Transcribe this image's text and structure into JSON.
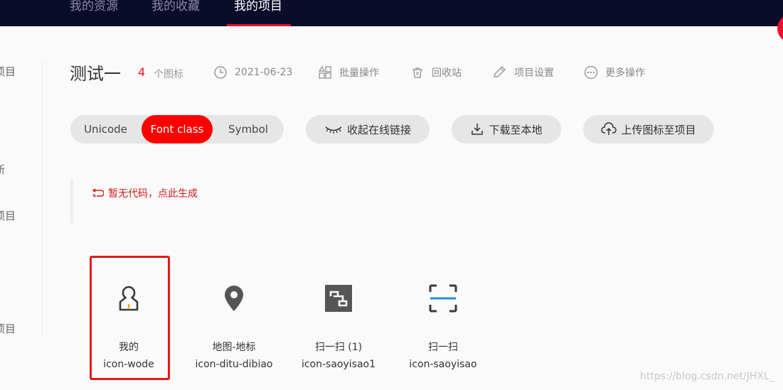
{
  "topnav": {
    "items": [
      {
        "label": "我的资源"
      },
      {
        "label": "我的收藏"
      },
      {
        "label": "我的项目",
        "active": true
      }
    ]
  },
  "sidebar": {
    "fragments": [
      "项目",
      "新",
      "项目",
      "项目"
    ]
  },
  "project": {
    "title": "测试一",
    "icon_count": "4",
    "icon_count_label": "个图标",
    "date": "2021-06-23",
    "batch_label": "批量操作",
    "recycle_label": "回收站",
    "settings_label": "项目设置",
    "more_label": "更多操作"
  },
  "modes": {
    "items": [
      "Unicode",
      "Font class",
      "Symbol"
    ],
    "active": "Font class"
  },
  "actions": {
    "collapse_label": "收起在线链接",
    "download_label": "下载至本地",
    "upload_label": "上传图标至项目"
  },
  "code": {
    "empty_label": "暂无代码，点此生成"
  },
  "icons": [
    {
      "name": "我的",
      "code": "icon-wode",
      "icon": "user-icon",
      "highlighted": true
    },
    {
      "name": "地图-地标",
      "code": "icon-ditu-dibiao",
      "icon": "map-pin-icon"
    },
    {
      "name": "扫一扫 (1)",
      "code": "icon-saoyisao1",
      "icon": "scan-square-icon"
    },
    {
      "name": "扫一扫",
      "code": "icon-saoyisao",
      "icon": "scan-frame-icon"
    }
  ],
  "colors": {
    "accent": "#ff0000",
    "topbar": "#0b0b2a",
    "highlight_border": "#e81717"
  },
  "watermark": "https://blog.csdn.net/JHXL_"
}
